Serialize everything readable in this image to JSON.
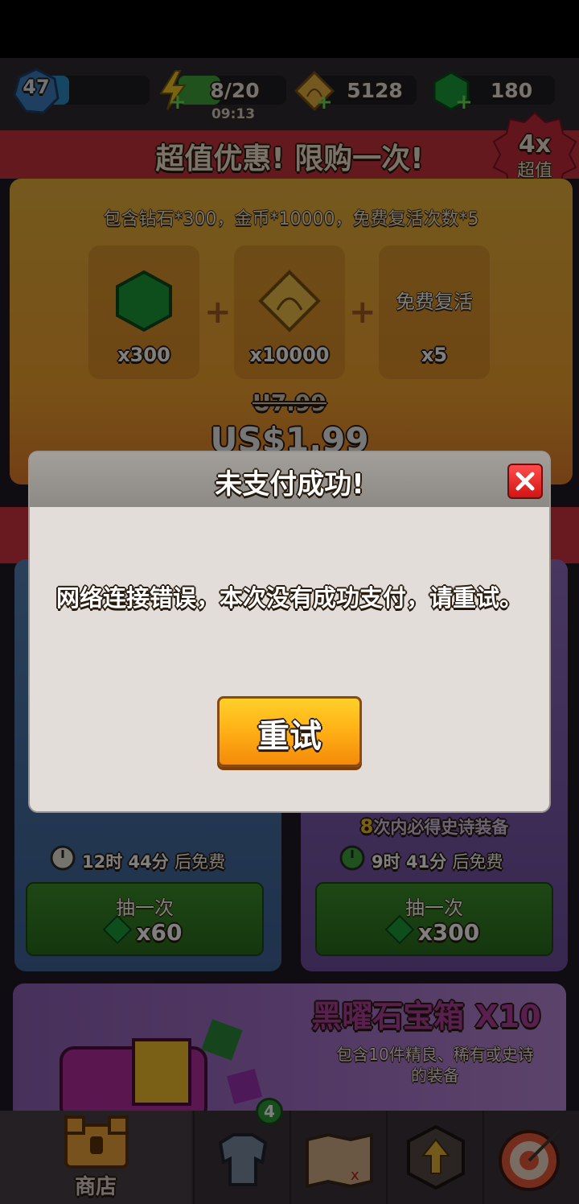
{
  "resource_bar": {
    "level": "47",
    "energy": "8/20",
    "energy_timer": "09:13",
    "coins": "5128",
    "gems": "180"
  },
  "offer": {
    "banner_title": "超值优惠! 限购一次!",
    "badge_multiplier": "4x",
    "badge_text": "超值",
    "description": "包含钻石*300，金币*10000，免费复活次数*5",
    "items": [
      {
        "icon": "gem-icon",
        "qty": "x300"
      },
      {
        "icon": "coin-bow-icon",
        "label": "",
        "qty": "x10000"
      },
      {
        "icon": "",
        "label": "免费复活",
        "qty": "x5"
      }
    ],
    "old_price": "U7.99",
    "price": "US$1.99"
  },
  "chests": {
    "left": {
      "timer_h": "12",
      "timer_h_unit": "时",
      "timer_m": "44",
      "timer_m_unit": "分",
      "timer_suffix": "后免费",
      "draw_label": "抽一次",
      "cost": "x60"
    },
    "right": {
      "guarantee_num": "8",
      "guarantee_text": "次内必得史诗装备",
      "timer_h": "9",
      "timer_h_unit": "时",
      "timer_m": "41",
      "timer_m_unit": "分",
      "timer_suffix": "后免费",
      "draw_label": "抽一次",
      "cost": "x300"
    }
  },
  "obsidian": {
    "title": "黑曜石宝箱 X10",
    "desc_line1": "包含10件精良、稀有或史诗",
    "desc_line2": "的装备"
  },
  "bottom_nav": {
    "shop_label": "商店",
    "equipment_badge": "4"
  },
  "dialog": {
    "title": "未支付成功!",
    "message": "网络连接错误，本次没有成功支付，请重试。",
    "retry_label": "重试"
  },
  "colors": {
    "energy_green": "#3fa53a",
    "retry_orange": "#ffb317",
    "close_red": "#e12020"
  }
}
